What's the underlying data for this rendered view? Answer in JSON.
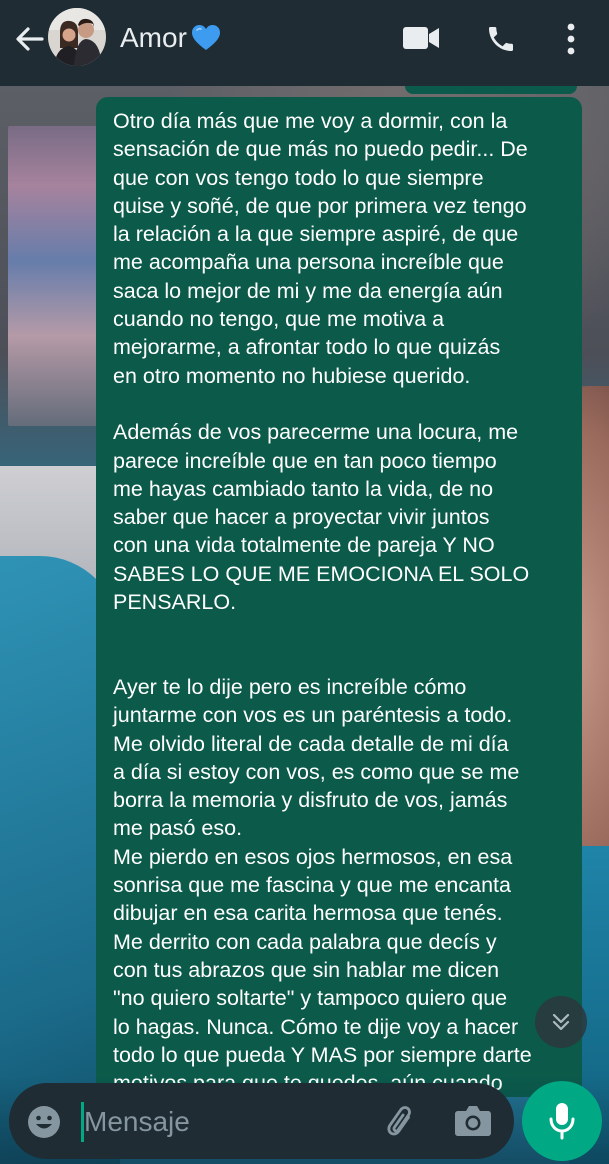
{
  "header": {
    "contact_name": "Amor",
    "name_emoji": "blue-heart-icon"
  },
  "message": {
    "paragraphs": [
      "Otro día más que me voy a dormir, con la\nsensación de que más no puedo pedir... De\nque con vos tengo todo lo que siempre\nquise y soñé, de que por primera vez tengo\nla relación a la que siempre aspiré, de que\nme acompaña una persona increíble que\nsaca lo mejor de mi y me da energía aún\ncuando no tengo, que me motiva a\nmejorarme, a afrontar todo lo que quizás\nen otro momento no hubiese querido.",
      "Además de vos parecerme una locura, me\nparece increíble que en tan poco tiempo\nme hayas cambiado tanto la vida, de no\nsaber que hacer a proyectar vivir juntos\ncon una vida totalmente de pareja Y NO\nSABES LO QUE ME EMOCIONA EL SOLO\nPENSARLO.",
      "Ayer te lo dije pero es increíble cómo\njuntarme con vos es un paréntesis a todo.\nMe olvido literal de cada detalle de mi día\na día si estoy con vos, es como que se me\nborra la memoria y disfruto de vos, jamás\nme pasó eso.\nMe pierdo en esos ojos hermosos, en esa\nsonrisa que me fascina y que me encanta\ndibujar en esa carita hermosa que tenés.\nMe derrito con cada palabra que decís y\ncon tus abrazos que sin hablar me dicen\n\"no quiero soltarte\" y tampoco quiero que\nlo hagas. Nunca. Cómo te dije voy a hacer\ntodo lo que pueda Y MAS por siempre darte\nmotivos para que te quedes, aún cuando"
    ]
  },
  "composer": {
    "placeholder": "Mensaje"
  },
  "colors": {
    "header_bg": "#1f2c34",
    "bubble_bg": "#0b5a4a",
    "accent": "#00a884"
  }
}
